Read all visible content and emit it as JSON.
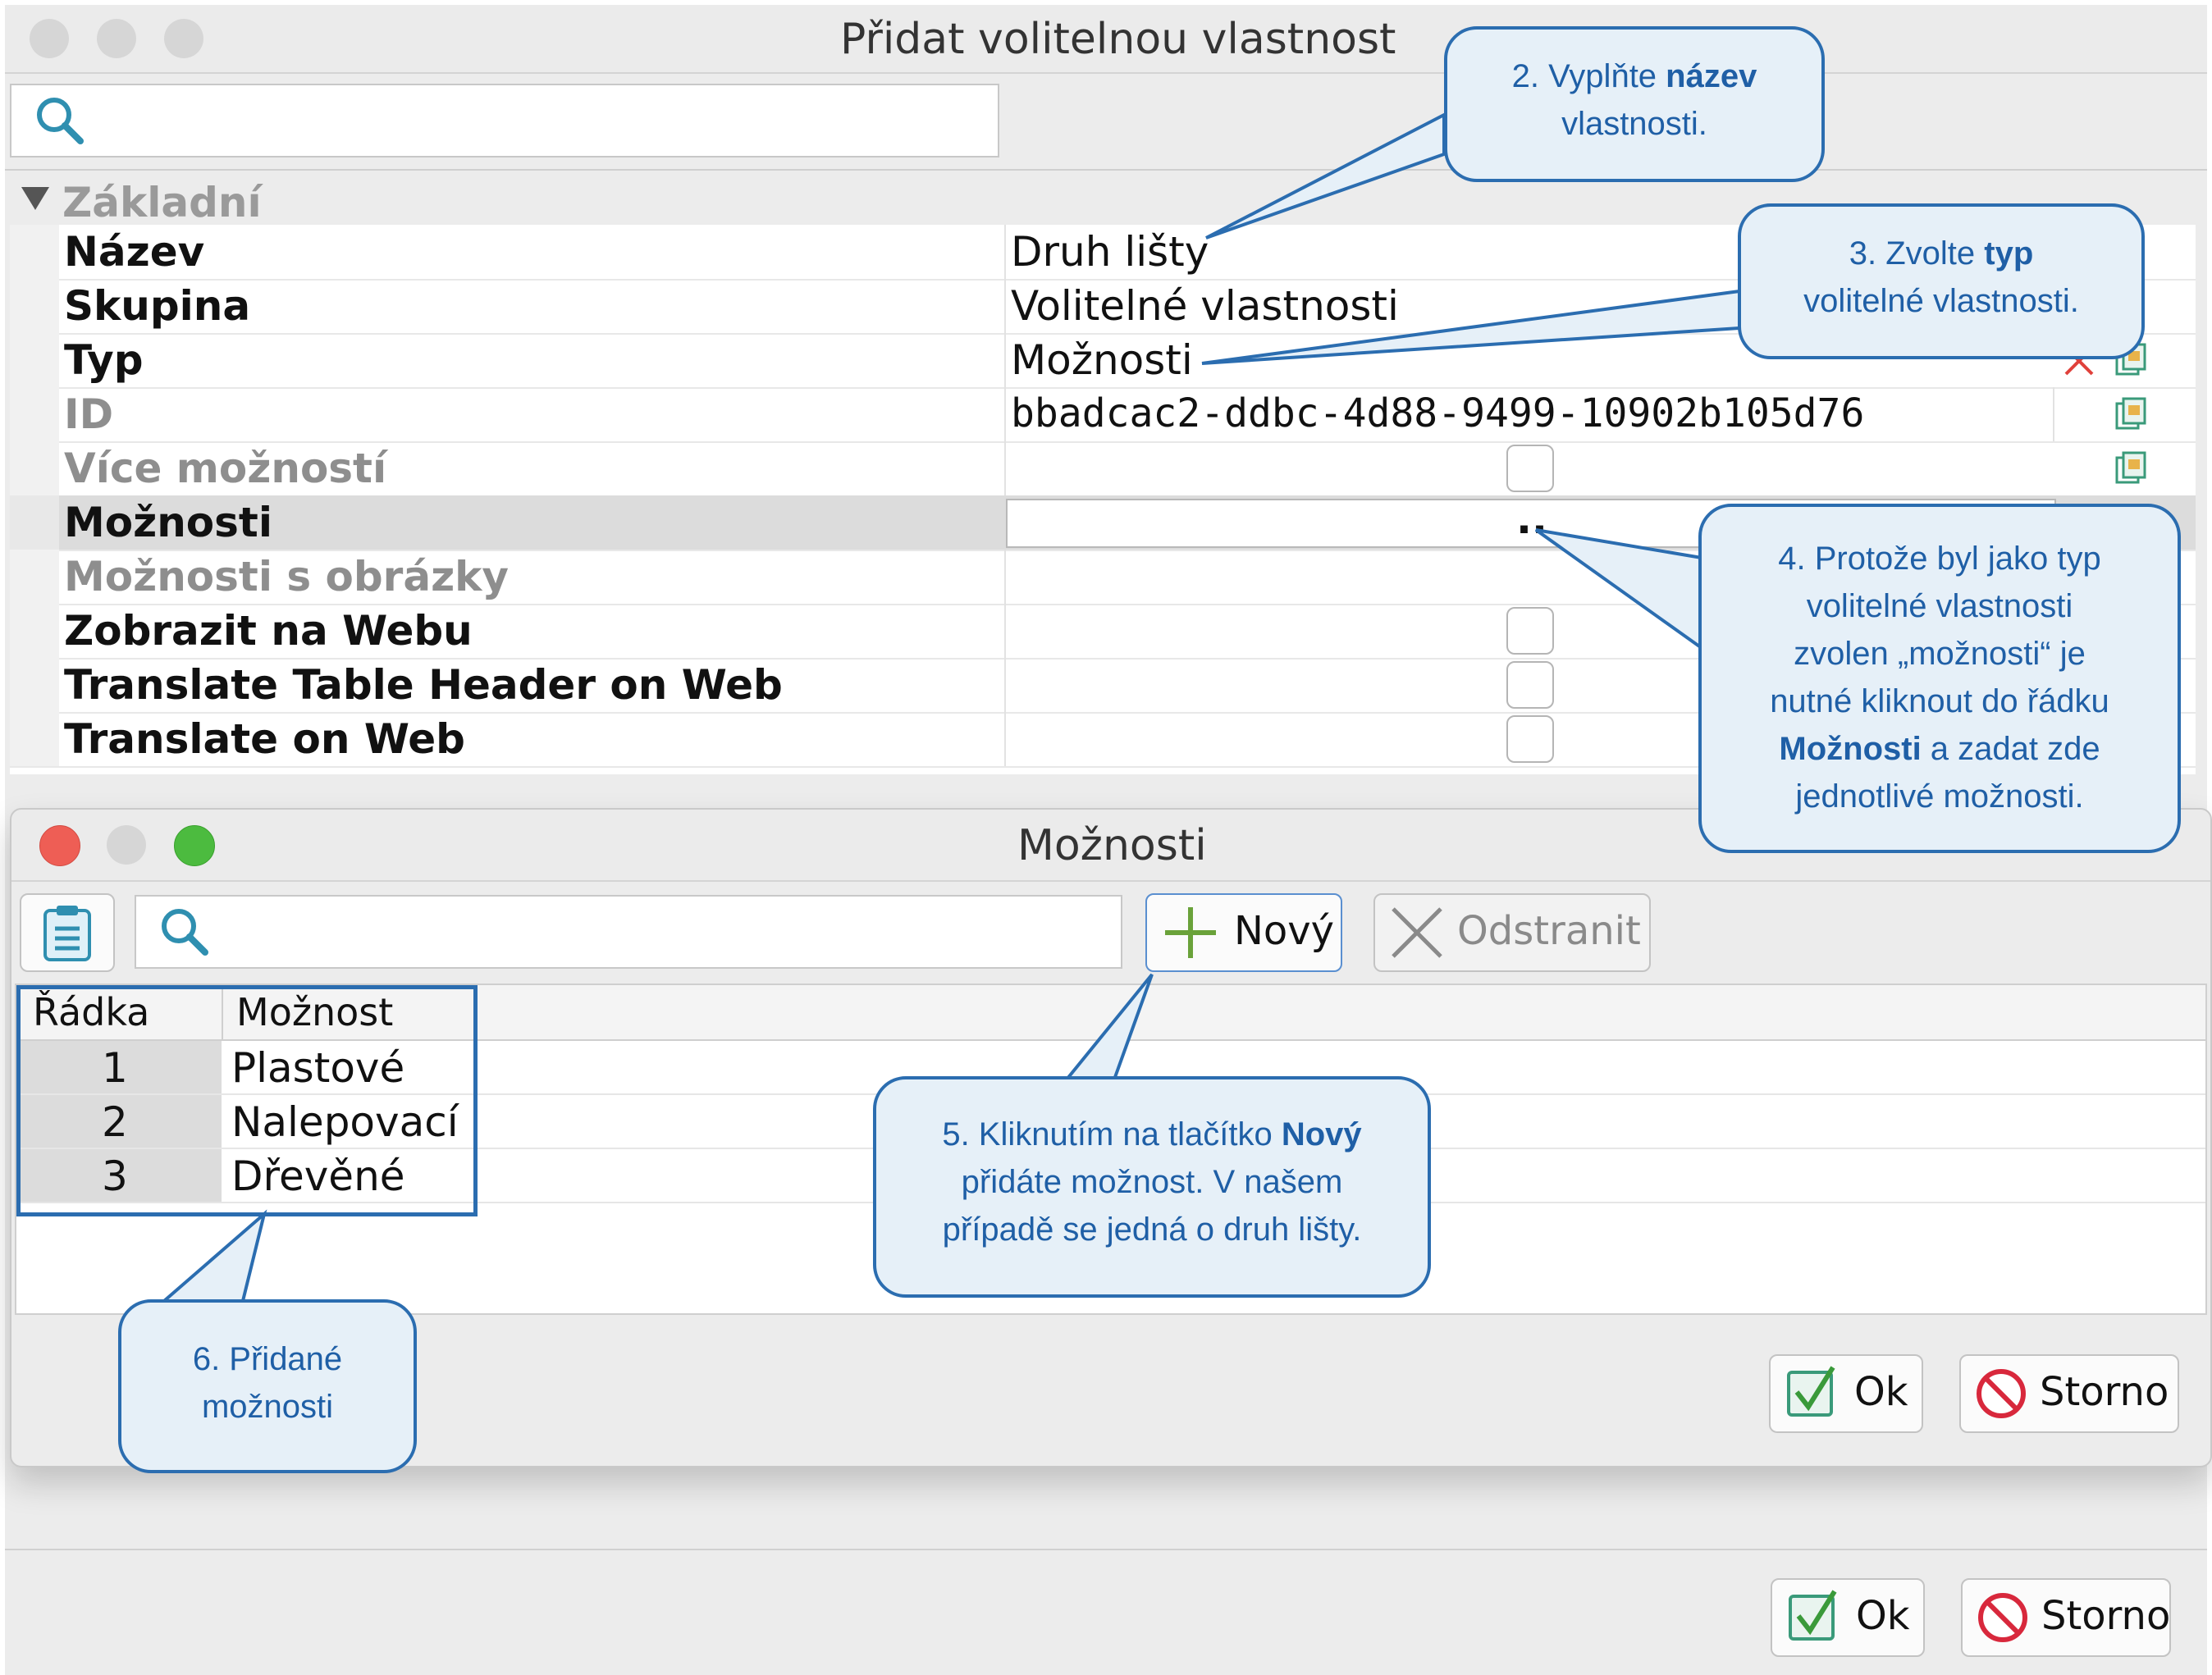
{
  "main_window": {
    "title": "Přidat volitelnou vlastnost",
    "section": "Základní",
    "rows": [
      {
        "label": "Název",
        "value": "Druh lišty"
      },
      {
        "label": "Skupina",
        "value": "Volitelné vlastnosti"
      },
      {
        "label": "Typ",
        "value": "Možnosti"
      },
      {
        "label": "ID",
        "value": "bbadcac2-ddbc-4d88-9499-10902b105d76"
      },
      {
        "label": "Více možností",
        "value": ""
      },
      {
        "label": "Možnosti",
        "value": ".."
      },
      {
        "label": "Možnosti s obrázky",
        "value": ""
      },
      {
        "label": "Zobrazit na Webu",
        "value": ""
      },
      {
        "label": "Translate Table Header on Web",
        "value": ""
      },
      {
        "label": "Translate on Web",
        "value": ""
      }
    ],
    "ok_label": "Ok",
    "cancel_label": "Storno"
  },
  "options_dialog": {
    "title": "Možnosti",
    "new_label": "Nový",
    "remove_label": "Odstranit",
    "columns": [
      "Řádka",
      "Možnost"
    ],
    "items": [
      {
        "row": "1",
        "option": "Plastové"
      },
      {
        "row": "2",
        "option": "Nalepovací"
      },
      {
        "row": "3",
        "option": "Dřevěné"
      }
    ],
    "ok_label": "Ok",
    "cancel_label": "Storno"
  },
  "callouts": {
    "c2_pre": "2. Vyplňte ",
    "c2_bold": "název",
    "c2_post": "vlastnosti.",
    "c3_pre": "3. Zvolte ",
    "c3_bold": "typ",
    "c3_post": "volitelné vlastnosti.",
    "c4_l1": "4. Protože byl jako typ",
    "c4_l2": "volitelné vlastnosti",
    "c4_l3": "zvolen „možnosti“ je",
    "c4_l4": "nutné kliknout do řádku",
    "c4_bold": "Možnosti",
    "c4_l5": " a zadat zde",
    "c4_l6": "jednotlivé možnosti.",
    "c5_pre": "5. Kliknutím na tlačítko ",
    "c5_bold": "Nový",
    "c5_l2": "přidáte možnost. V našem",
    "c5_l3": "případě se jedná o druh lišty.",
    "c6_l1": "6. Přidané",
    "c6_l2": "možnosti"
  },
  "colors": {
    "callout_border": "#2b6db0",
    "callout_fill": "#e6f0f8",
    "callout_text": "#1f5fa6",
    "close_red": "#ee5e55",
    "zoom_green": "#4cbb3f"
  }
}
